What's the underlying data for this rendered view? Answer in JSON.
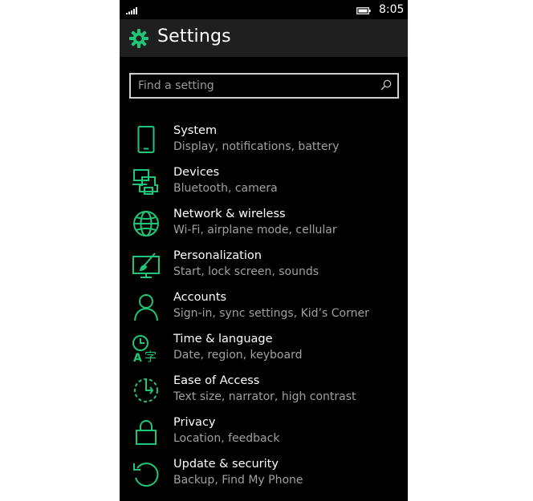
{
  "status_bar": {
    "time": "8:05"
  },
  "header": {
    "title": "Settings",
    "icon": "gear-icon"
  },
  "search": {
    "placeholder": "Find a setting",
    "value": ""
  },
  "colors": {
    "accent": "#1ec776",
    "background": "#000000",
    "header_background": "#1f1f1f",
    "title_text": "#ffffff",
    "subtitle_text": "#a0a0a0"
  },
  "settings": {
    "items": [
      {
        "title": "System",
        "subtitle": "Display, notifications, battery",
        "icon": "phone-icon"
      },
      {
        "title": "Devices",
        "subtitle": "Bluetooth, camera",
        "icon": "devices-icon"
      },
      {
        "title": "Network & wireless",
        "subtitle": "Wi-Fi, airplane mode, cellular",
        "icon": "globe-icon"
      },
      {
        "title": "Personalization",
        "subtitle": "Start, lock screen, sounds",
        "icon": "paint-icon"
      },
      {
        "title": "Accounts",
        "subtitle": "Sign-in, sync settings, Kid’s Corner",
        "icon": "person-icon"
      },
      {
        "title": "Time & language",
        "subtitle": "Date, region, keyboard",
        "icon": "time-language-icon"
      },
      {
        "title": "Ease of Access",
        "subtitle": "Text size, narrator, high contrast",
        "icon": "ease-of-access-icon"
      },
      {
        "title": "Privacy",
        "subtitle": "Location, feedback",
        "icon": "lock-icon"
      },
      {
        "title": "Update & security",
        "subtitle": "Backup, Find My Phone",
        "icon": "update-icon"
      }
    ]
  }
}
